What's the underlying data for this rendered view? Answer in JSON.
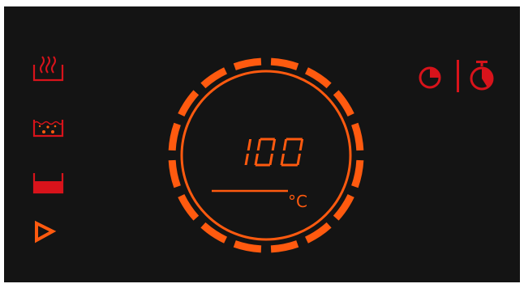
{
  "display": {
    "temperature_value": "100",
    "unit": "°C",
    "progress_segments": 16,
    "active_segments": 16
  },
  "side_controls": [
    {
      "name": "steam-mode-icon"
    },
    {
      "name": "boil-mode-icon"
    },
    {
      "name": "water-level-icon"
    },
    {
      "name": "start-icon"
    }
  ],
  "timer_controls": [
    {
      "name": "clock-timer-icon"
    },
    {
      "name": "stopwatch-timer-icon"
    }
  ],
  "colors": {
    "background": "#141414",
    "accent_orange": "#ff5a0f",
    "accent_red": "#d8131b"
  }
}
